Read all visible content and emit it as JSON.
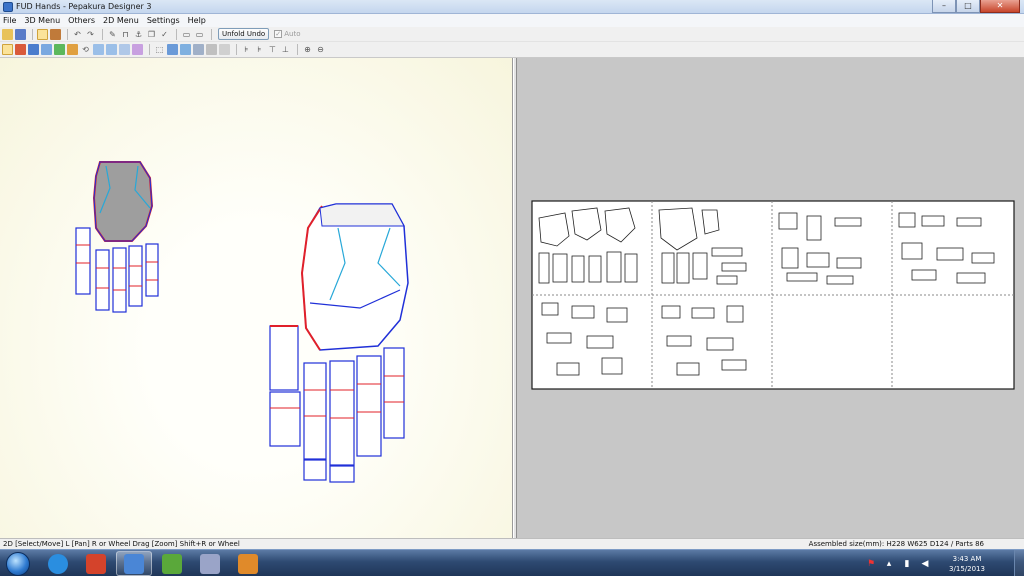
{
  "window": {
    "title": "FUD Hands - Pepakura Designer 3",
    "minimize_glyph": "–",
    "maximize_glyph": "□",
    "close_glyph": "✕"
  },
  "menu": [
    "File",
    "3D Menu",
    "Others",
    "2D Menu",
    "Settings",
    "Help"
  ],
  "toolbar": {
    "unfold_undo_label": "Unfold Undo",
    "auto_label": "Auto",
    "auto_checked": true
  },
  "status": {
    "left_text": "2D [Select/Move] L [Pan] R or Wheel Drag [Zoom] Shift+R or Wheel",
    "right_text": "Assembled size(mm): H228 W625 D124 / Parts 86"
  },
  "taskbar": {
    "apps": [
      {
        "name": "internet-explorer",
        "color": "#2a8ee0",
        "active": false
      },
      {
        "name": "pepakura-unfolder",
        "color": "#d4432b",
        "active": false
      },
      {
        "name": "pepakura-designer",
        "color": "#4a86d6",
        "active": true
      },
      {
        "name": "notepad-plus",
        "color": "#5aa83a",
        "active": false
      },
      {
        "name": "media-app",
        "color": "#9aa4c8",
        "active": false
      },
      {
        "name": "paint-app",
        "color": "#e08a2a",
        "active": false
      }
    ],
    "clock_time": "3:43 AM",
    "clock_date": "3/15/2013"
  },
  "colors": {
    "accent": "#3b73c9",
    "model_outline_red": "#e0202a",
    "model_outline_blue": "#2030d8",
    "model_fill_gray": "#9e9e9e",
    "paper_bg": "#ffffff",
    "pane2d_bg": "#c7c7c7"
  }
}
